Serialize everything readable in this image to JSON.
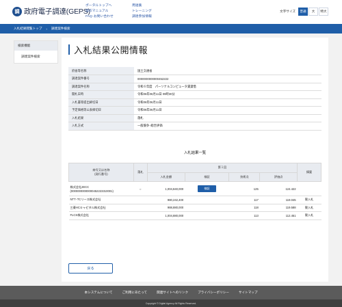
{
  "header": {
    "logo_mark": "調",
    "site_name": "政府電子調達(GEPS)",
    "links_col1": [
      "ポータルトップへ",
      "操作マニュアル",
      "FAQ･お問い合わせ"
    ],
    "links_col2": [
      "用語集",
      "トレーニング",
      "調達参加情報"
    ],
    "font_size_label": "文字サイズ",
    "font_sizes": [
      "普通",
      "大",
      "特大"
    ],
    "active_font_size": "普通"
  },
  "breadcrumb": [
    "入札結果閲覧トップ",
    "調達案件検索"
  ],
  "sidebar": {
    "heading": "検索機能",
    "items": [
      "調達案件検索"
    ]
  },
  "page_title": "入札結果公開情報",
  "info": [
    {
      "label": "府省等名称",
      "value": "国土交通省"
    },
    {
      "label": "調達案件番号",
      "value": "0000000000000452222"
    },
    {
      "label": "調達案件名称",
      "value": "令和６年度　パーソナルコンピュータ賃貸借"
    },
    {
      "label": "開札日時",
      "value": "令和06年06月11日 09時30分"
    },
    {
      "label": "入札書等提出締切日",
      "value": "令和06年06月11日"
    },
    {
      "label": "予定価格等公表締切日",
      "value": "令和06年06月11日"
    },
    {
      "label": "入札結果",
      "value": "落札"
    },
    {
      "label": "入札方式",
      "value": "一般競争･総合評価"
    }
  ],
  "results": {
    "title": "入札結果一覧",
    "headers": {
      "company": "商号又は名称\n(発行番号)",
      "winner": "落札",
      "round": "第１回",
      "amount": "入札金額",
      "inspect": "検証",
      "tech_score": "技術点",
      "eval_score": "評価点",
      "remarks": "摘要"
    },
    "rows": [
      {
        "company": "株式会社JECC",
        "number": "(00000000000000452223310001)",
        "winner": "○",
        "amount": "1,004,840,000",
        "inspect": "検証",
        "tech": "125",
        "eval": "124.422",
        "remarks": ""
      },
      {
        "company": "NTT･TCリース株式会社",
        "number": "",
        "winner": "",
        "amount": "980,242,400",
        "inspect": "",
        "tech": "117",
        "eval": "119.045",
        "remarks": "競入札"
      },
      {
        "company": "三菱HCキャピタル株式会社",
        "number": "",
        "winner": "",
        "amount": "988,880,000",
        "inspect": "",
        "tech": "118",
        "eval": "119.588",
        "remarks": "競入札"
      },
      {
        "company": "FLCS株式会社",
        "number": "",
        "winner": "",
        "amount": "1,004,880,000",
        "inspect": "",
        "tech": "113",
        "eval": "112.451",
        "remarks": "競入札"
      }
    ]
  },
  "back_button": "戻る",
  "footer": {
    "links": [
      "本システムについて",
      "ご利用にあたって",
      "関連サイトへのリンク",
      "プライバシーポリシー",
      "サイトマップ"
    ],
    "copyright": "Copyright © Digital Agency All Rights Reserved."
  }
}
